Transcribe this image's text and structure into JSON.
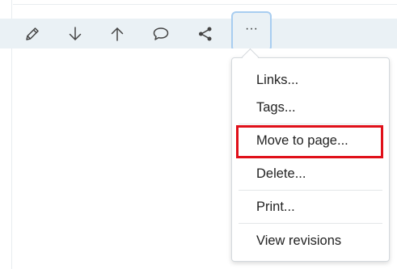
{
  "toolbar": {
    "buttons": [
      {
        "name": "edit",
        "icon": "pencil-icon"
      },
      {
        "name": "move-down",
        "icon": "arrow-down-icon"
      },
      {
        "name": "move-up",
        "icon": "arrow-up-icon"
      },
      {
        "name": "comment",
        "icon": "speech-bubble-icon"
      },
      {
        "name": "share",
        "icon": "share-icon"
      },
      {
        "name": "more",
        "icon": "ellipsis-icon",
        "label": "···"
      }
    ]
  },
  "menu": {
    "items": [
      {
        "label": "Links..."
      },
      {
        "label": "Tags..."
      },
      {
        "label": "Move to page..."
      },
      {
        "label": "Delete..."
      },
      {
        "label": "Print..."
      },
      {
        "label": "View revisions"
      }
    ]
  },
  "colors": {
    "toolbar_bg": "#eaf1f5",
    "active_outline": "#a8cdf0",
    "highlight": "#e0101a"
  }
}
